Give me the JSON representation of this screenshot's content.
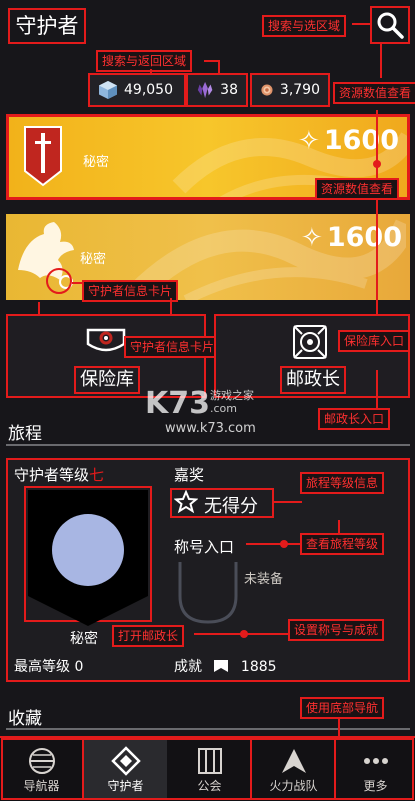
{
  "header": {
    "title": "守护者"
  },
  "resources": [
    {
      "icon": "glimmer-cube-icon",
      "value": "49,050"
    },
    {
      "icon": "bright-dust-icon",
      "value": "38"
    },
    {
      "icon": "silver-coin-icon",
      "value": "3,790"
    }
  ],
  "cards": [
    {
      "label": "秘密",
      "points": "1600",
      "icon": "sword-emblem-icon"
    },
    {
      "label": "秘密",
      "points": "1600",
      "icon": "phoenix-emblem-icon"
    }
  ],
  "vault": {
    "label": "保险库",
    "icon": "vault-icon"
  },
  "postmaster": {
    "label": "邮政长",
    "icon": "postmaster-icon"
  },
  "watermark": {
    "logo": "K73",
    "cn": "游戏之家",
    "com": ".com",
    "url": "www.k73.com"
  },
  "journey": {
    "section_title": "旅程",
    "level_label": "守护者等级",
    "level_suffix": "七",
    "reward_label": "嘉奖",
    "reward_value": "无得分",
    "title_entry": "称号入口",
    "unequipped": "未装备",
    "secret": "秘密",
    "max_level_label": "最高等级",
    "max_level_value": "0",
    "triumph_label": "成就",
    "triumph_value": "1885"
  },
  "collections": {
    "section_title": "收藏"
  },
  "nav": [
    {
      "label": "导航器",
      "icon": "director-icon"
    },
    {
      "label": "守护者",
      "icon": "guardian-icon"
    },
    {
      "label": "公会",
      "icon": "clan-icon"
    },
    {
      "label": "火力战队",
      "icon": "fireteam-icon"
    },
    {
      "label": "更多",
      "icon": "more-dots-icon"
    }
  ],
  "annotations": {
    "search": "搜索与选区域",
    "search_back": "搜索与返回区域",
    "res_view1": "资源数值查看",
    "res_view2": "资源数值查看",
    "info_card1": "守护者信息卡片",
    "info_card2": "守护者信息卡片",
    "vault_entry": "保险库入口",
    "post_entry": "邮政长入口",
    "journey_info": "旅程等级信息",
    "view_journey": "查看旅程等级",
    "open_post": "打开邮政长",
    "set_title": "设置称号与成就",
    "use_nav": "使用底部导航"
  },
  "colors": {
    "annotation": "#e31b1b",
    "gold": "#f2b21a",
    "bg": "#17161a"
  }
}
